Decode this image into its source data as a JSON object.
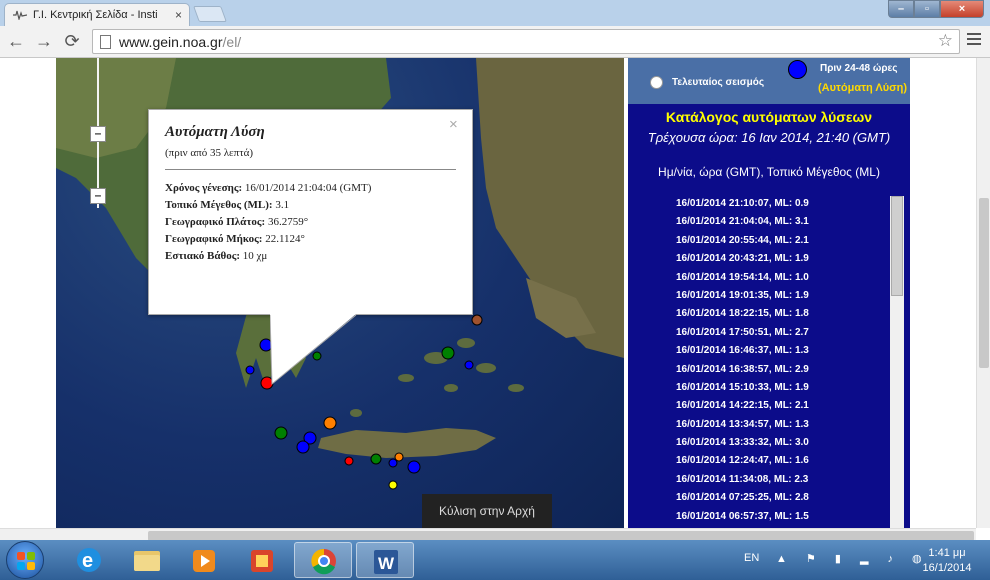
{
  "browser": {
    "tab_title": "Γ.Ι. Κεντρική Σελίδα - Insti",
    "tab_close": "×",
    "url_host": "www.gein.noa.gr",
    "url_path": "/el/"
  },
  "map": {
    "popup": {
      "title": "Αυτόματη Λύση",
      "subtitle": "(πριν από 35 λεπτά)",
      "close": "×",
      "rows": [
        {
          "label": "Χρόνος γένεσης:",
          "value": " 16/01/2014  21:04:04 (GMT)"
        },
        {
          "label": "Τοπικό Μέγεθος (ML):",
          "value": " 3.1"
        },
        {
          "label": "Γεωγραφικό Πλάτος:",
          "value": " 36.2759°"
        },
        {
          "label": "Γεωγραφικό Μήκος:",
          "value": " 22.1124°"
        },
        {
          "label": "Εστιακό Βάθος:",
          "value": " 10 χμ"
        }
      ]
    },
    "scroll_top_label": "Κύλιση στην Αρχή",
    "markers": [
      {
        "color": "#0000ff",
        "size": "large"
      },
      {
        "color": "#0000ff",
        "size": "small"
      },
      {
        "color": "#008000",
        "size": "small"
      },
      {
        "color": "#ff0000",
        "size": "large"
      },
      {
        "color": "#008000",
        "size": "medium"
      },
      {
        "color": "#0000ff",
        "size": "large"
      },
      {
        "color": "#0000ff",
        "size": "large"
      },
      {
        "color": "#ff7f00",
        "size": "medium"
      },
      {
        "color": "#008000",
        "size": "medium"
      },
      {
        "color": "#0000ff",
        "size": "small"
      },
      {
        "color": "#a0522d",
        "size": "medium"
      },
      {
        "color": "#ff0000",
        "size": "small"
      },
      {
        "color": "#008000",
        "size": "small"
      },
      {
        "color": "#0000ff",
        "size": "small"
      },
      {
        "color": "#ff7f00",
        "size": "small"
      },
      {
        "color": "#0000ff",
        "size": "medium"
      },
      {
        "color": "#ffff00",
        "size": "small"
      }
    ]
  },
  "panel": {
    "latest_label": "Τελευταίος σεισμός",
    "legend_label": "Πριν 24-48 ώρες",
    "auto_label": "(Αυτόματη Λύση)",
    "catalog_title": "Κατάλογος αυτόματων λύσεων",
    "current_time": "Τρέχουσα ώρα: 16 Ιαν 2014, 21:40 (GMT)",
    "columns": "Ημ/νία, ώρα (GMT), Τοπικό Μέγεθος (ML)",
    "quakes": [
      "16/01/2014  21:10:07,  ML: 0.9",
      "16/01/2014  21:04:04,  ML: 3.1",
      "16/01/2014  20:55:44,  ML: 2.1",
      "16/01/2014  20:43:21,  ML: 1.9",
      "16/01/2014  19:54:14,  ML: 1.0",
      "16/01/2014  19:01:35,  ML: 1.9",
      "16/01/2014  18:22:15,  ML: 1.8",
      "16/01/2014  17:50:51,  ML: 2.7",
      "16/01/2014  16:46:37,  ML: 1.3",
      "16/01/2014  16:38:57,  ML: 2.9",
      "16/01/2014  15:10:33,  ML: 1.9",
      "16/01/2014  14:22:15,  ML: 2.1",
      "16/01/2014  13:34:57,  ML: 1.3",
      "16/01/2014  13:33:32,  ML: 3.0",
      "16/01/2014  12:24:47,  ML: 1.6",
      "16/01/2014  11:34:08,  ML: 2.3",
      "16/01/2014  07:25:25,  ML: 2.8",
      "16/01/2014  06:57:37,  ML: 1.5"
    ]
  },
  "taskbar": {
    "lang": "EN",
    "time": "1:41 μμ",
    "date": "16/1/2014"
  }
}
